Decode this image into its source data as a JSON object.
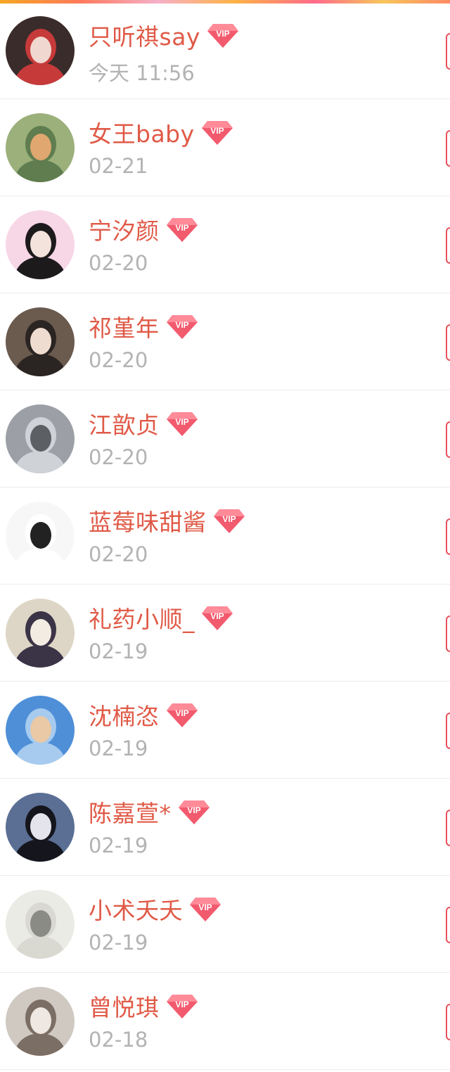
{
  "colors": {
    "name": "#e05a47",
    "time": "#b3b3b3",
    "vip_badge": "#f25a6e",
    "edge_button": "#e8505b",
    "divider": "#ececec"
  },
  "vip_badge_text": "VIP",
  "contacts": [
    {
      "name": "只听祺say",
      "time": "今天 11:56",
      "avatar": [
        "#3a2c2a",
        "#c63a3a",
        "#f0d7cf"
      ]
    },
    {
      "name": "女王baby",
      "time": "02-21",
      "avatar": [
        "#9bb07a",
        "#5f7d4e",
        "#e0a770"
      ]
    },
    {
      "name": "宁汐颜",
      "time": "02-20",
      "avatar": [
        "#f7d6e6",
        "#1d1a1c",
        "#f3e3dc"
      ]
    },
    {
      "name": "祁堇年",
      "time": "02-20",
      "avatar": [
        "#6b5a4e",
        "#2a2422",
        "#efdcd0"
      ]
    },
    {
      "name": "江歆贞",
      "time": "02-20",
      "avatar": [
        "#9ca0a6",
        "#cfd2d6",
        "#5c5f63"
      ]
    },
    {
      "name": "蓝莓味甜酱",
      "time": "02-20",
      "avatar": [
        "#f7f7f7",
        "#ffffff",
        "#222222"
      ]
    },
    {
      "name": "礼药小顺_",
      "time": "02-19",
      "avatar": [
        "#ddd6c6",
        "#3b3346",
        "#f2ece2"
      ]
    },
    {
      "name": "沈楠恣",
      "time": "02-19",
      "avatar": [
        "#4f8fd8",
        "#a6cbef",
        "#e9c9a6"
      ]
    },
    {
      "name": "陈嘉萱*",
      "time": "02-19",
      "avatar": [
        "#5b6f94",
        "#15161d",
        "#e3e4ec"
      ]
    },
    {
      "name": "小术夭夭",
      "time": "02-19",
      "avatar": [
        "#ebebe6",
        "#d9d9d2",
        "#8b8b86"
      ]
    },
    {
      "name": "曾悦琪",
      "time": "02-18",
      "avatar": [
        "#cfc9c2",
        "#7b6e64",
        "#efe7e1"
      ]
    }
  ]
}
